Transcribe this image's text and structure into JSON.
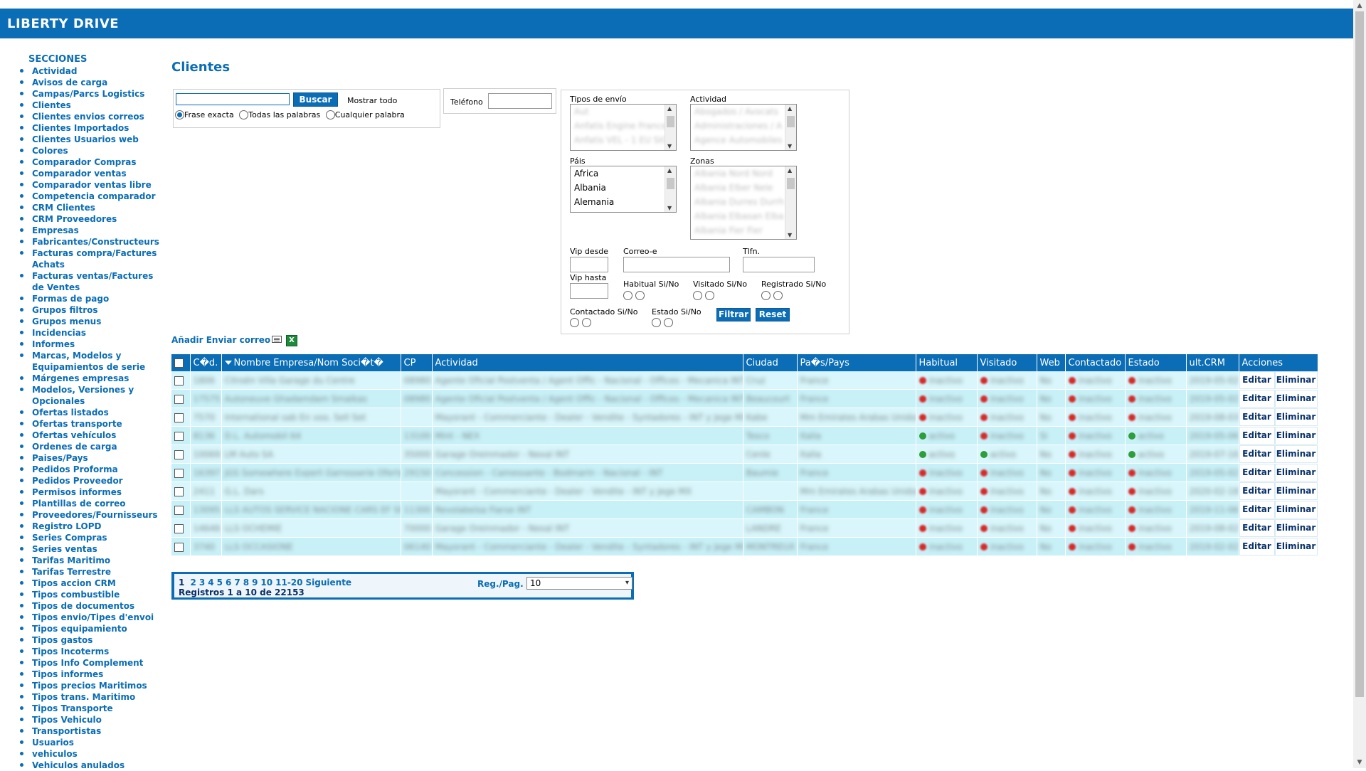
{
  "app": {
    "brand": "LIBERTY DRIVE",
    "accent": "#0a6db5"
  },
  "sidebar": {
    "title": "SECCIONES",
    "items": [
      "Actividad",
      "Avisos de carga",
      "Campas/Parcs Logistics",
      "Clientes",
      "Clientes envios correos",
      "Clientes Importados",
      "Clientes Usuarios web",
      "Colores",
      "Comparador Compras",
      "Comparador ventas",
      "Comparador ventas libre",
      "Competencia comparador",
      "CRM Clientes",
      "CRM Proveedores",
      "Empresas",
      "Fabricantes/Constructeurs",
      "Facturas compra/Factures Achats",
      "Facturas ventas/Factures de Ventes",
      "Formas de pago",
      "Grupos filtros",
      "Grupos menus",
      "Incidencias",
      "Informes",
      "Marcas, Modelos y Equipamientos de serie",
      "Márgenes empresas",
      "Modelos, Versiones y Opcionales",
      "Ofertas listados",
      "Ofertas transporte",
      "Ofertas vehículos",
      "Ordenes de carga",
      "Paises/Pays",
      "Pedidos Proforma",
      "Pedidos Proveedor",
      "Permisos informes",
      "Plantillas de correo",
      "Proveedores/Fournisseurs",
      "Registro LOPD",
      "Series Compras",
      "Series ventas",
      "Tarifas Maritimo",
      "Tarifas Terrestre",
      "Tipos accion CRM",
      "Tipos combustible",
      "Tipos de documentos",
      "Tipos envio/Tipes d'envoi",
      "Tipos equipamiento",
      "Tipos gastos",
      "Tipos Incoterms",
      "Tipos Info Complement",
      "Tipos informes",
      "Tipos precios Maritimos",
      "Tipos trans. Maritimo",
      "Tipos Transporte",
      "Tipos Vehiculo",
      "Transportistas",
      "Usuarios",
      "vehiculos",
      "Vehiculos anulados"
    ]
  },
  "page": {
    "title": "Clientes"
  },
  "search": {
    "value": "",
    "button": "Buscar",
    "show_all": "Mostrar todo",
    "modes": [
      "Frase exacta",
      "Todas las palabras",
      "Cualquier palabra"
    ],
    "selected_mode": "Frase exacta",
    "phone_label": "Teléfono"
  },
  "filters": {
    "tipos_envio_label": "Tipos de envío",
    "tipos_envio_options": [
      "Aut",
      "Anfatis Engine France",
      "Anfatis VEL - 1 EU SIC"
    ],
    "actividad_label": "Actividad",
    "actividad_options": [
      "Abogados / Avocats",
      "Administraciones / A",
      "Agence Automobiles"
    ],
    "pais_label": "Páis",
    "pais_options": [
      "Africa",
      "Albania",
      "Alemania"
    ],
    "zonas_label": "Zonas",
    "zonas_options": [
      "Albania Nord Nord",
      "Albania Elber Nele",
      "Albania Durres Durrh",
      "Albania Elbasan Elba",
      "Albania Fier Fier"
    ],
    "vip_desde_label": "Vip desde",
    "vip_hasta_label": "Vip hasta",
    "correo_label": "Correo-e",
    "tlfn_label": "Tlfn.",
    "habitual_label": "Habitual Si/No",
    "visitado_label": "Visitado Si/No",
    "registrado_label": "Registrado Si/No",
    "contactado_label": "Contactado Si/No",
    "estado_label": "Estado Si/No",
    "filtrar_button": "Filtrar",
    "reset_button": "Reset"
  },
  "toolbar": {
    "add_mail": "Añadir Enviar correo"
  },
  "table": {
    "columns": [
      "Cód.",
      "Nombre Empresa/Nom Société",
      "CP",
      "Actividad",
      "Ciudad",
      "País/Pays",
      "Habitual",
      "Visitado",
      "Web",
      "Contactado",
      "Estado",
      "ult.CRM",
      "Acciones"
    ],
    "column_headers_display": [
      "C�d.",
      "Nombre Empresa/Nom Soci�t�",
      "CP",
      "Actividad",
      "Ciudad",
      "Pa�s/Pays",
      "Habitual",
      "Visitado",
      "Web",
      "Contactado",
      "Estado",
      "ult.CRM",
      "Acciones"
    ],
    "edit_label": "Editar",
    "delete_label": "Eliminar",
    "rows": [
      {
        "cod": "1806",
        "nombre": "Citroën Villa Garage du Centre",
        "cp": "08980",
        "actividad": "Agente Oficial Postventa / Agent Offic - Nacional - Offices - Mecanica INT",
        "ciudad": "Cruz",
        "pais": "France",
        "habitual": "inactivo",
        "visitado": "inactivo",
        "web": "No",
        "contactado": "inactivo",
        "estado": "inactivo",
        "ult_crm": "2019-05-02"
      },
      {
        "cod": "17575",
        "nombre": "Autoneuve Ghadamdam Smaikas",
        "cp": "08980",
        "actividad": "Agente Oficial Postventa / Agent Offic - Nacional - Offices - Mecanica INT",
        "ciudad": "Beaucourt",
        "pais": "France",
        "habitual": "inactivo",
        "visitado": "inactivo",
        "web": "No",
        "contactado": "inactivo",
        "estado": "inactivo",
        "ult_crm": "2019-05-02"
      },
      {
        "cod": "7570",
        "nombre": "International sab En voo. Sell Set",
        "cp": "",
        "actividad": "Mayorant - Commerciante - Dealer - Vendite - Syntadores - INT y Jege MX",
        "ciudad": "Kabe",
        "pais": "Mm Emirates Arabas Unidos",
        "habitual": "inactivo",
        "visitado": "inactivo",
        "web": "No",
        "contactado": "inactivo",
        "estado": "inactivo",
        "ult_crm": "2019-08-03"
      },
      {
        "cod": "8136",
        "nombre": "D.L. Automobil 64",
        "cp": "13100",
        "actividad": "Mint - NEX",
        "ciudad": "Tosco",
        "pais": "Italia",
        "habitual": "activo",
        "visitado": "inactivo",
        "web": "Si",
        "contactado": "inactivo",
        "estado": "activo",
        "ult_crm": "2019-05-06"
      },
      {
        "cod": "10069",
        "nombre": "LM Auto SA",
        "cp": "35000",
        "actividad": "Garage Oreinmador - Nexal INT",
        "ciudad": "Cenle",
        "pais": "Italia",
        "habitual": "activo",
        "visitado": "activo",
        "web": "No",
        "contactado": "inactivo",
        "estado": "activo",
        "ult_crm": "2019-07-16"
      },
      {
        "cod": "16397",
        "nombre": "JGS Somewhere Expert Garrosserie Ofertana",
        "cp": "29150",
        "actividad": "Concession - Camessante - Bodmarin - Nacional - INT",
        "ciudad": "Baumie",
        "pais": "France",
        "habitual": "inactivo",
        "visitado": "inactivo",
        "web": "No",
        "contactado": "inactivo",
        "estado": "inactivo",
        "ult_crm": "2019-05-02"
      },
      {
        "cod": "2411",
        "nombre": "G.L. Dars",
        "cp": "",
        "actividad": "Mayorant - Commerciante - Dealer - Vendite - INT y Jege MX",
        "ciudad": "",
        "pais": "Mm Emirates Arabas Unidos",
        "habitual": "inactivo",
        "visitado": "inactivo",
        "web": "No",
        "contactado": "inactivo",
        "estado": "inactivo",
        "ult_crm": "2020-02-18"
      },
      {
        "cod": "13095",
        "nombre": "LLS AUTOS SERVICE NACIONE CARS EF SOF",
        "cp": "11300",
        "actividad": "Revolabelsa Fiarse INT",
        "ciudad": "CAMBON",
        "pais": "France",
        "habitual": "inactivo",
        "visitado": "inactivo",
        "web": "No",
        "contactado": "inactivo",
        "estado": "inactivo",
        "ult_crm": "2019-11-06"
      },
      {
        "cod": "14646",
        "nombre": "LLS OCHEMIE",
        "cp": "70000",
        "actividad": "Garage Oreinmador - Nexal INT",
        "ciudad": "LANDRE",
        "pais": "France",
        "habitual": "inactivo",
        "visitado": "inactivo",
        "web": "No",
        "contactado": "inactivo",
        "estado": "inactivo",
        "ult_crm": "2019-08-02"
      },
      {
        "cod": "3740",
        "nombre": "LLS OCCASIONE",
        "cp": "06140",
        "actividad": "Mayorant - Commerciante - Dealer - Vendite - Syntadores - INT y Jege MX",
        "ciudad": "MONTREUX",
        "pais": "France",
        "habitual": "inactivo",
        "visitado": "inactivo",
        "web": "No",
        "contactado": "inactivo",
        "estado": "inactivo",
        "ult_crm": "2019-02-02"
      }
    ]
  },
  "pager": {
    "current_page": "1",
    "pages": [
      "2",
      "3",
      "4",
      "5",
      "6",
      "7",
      "8",
      "9",
      "10",
      "11-20",
      "Siguiente"
    ],
    "records": "Registros 1 a 10 de 22153",
    "per_page_label": "Reg./Pag.",
    "per_page_value": "10"
  },
  "status_colors": {
    "active": "#2e9d3a",
    "inactive": "#d62a2a"
  }
}
